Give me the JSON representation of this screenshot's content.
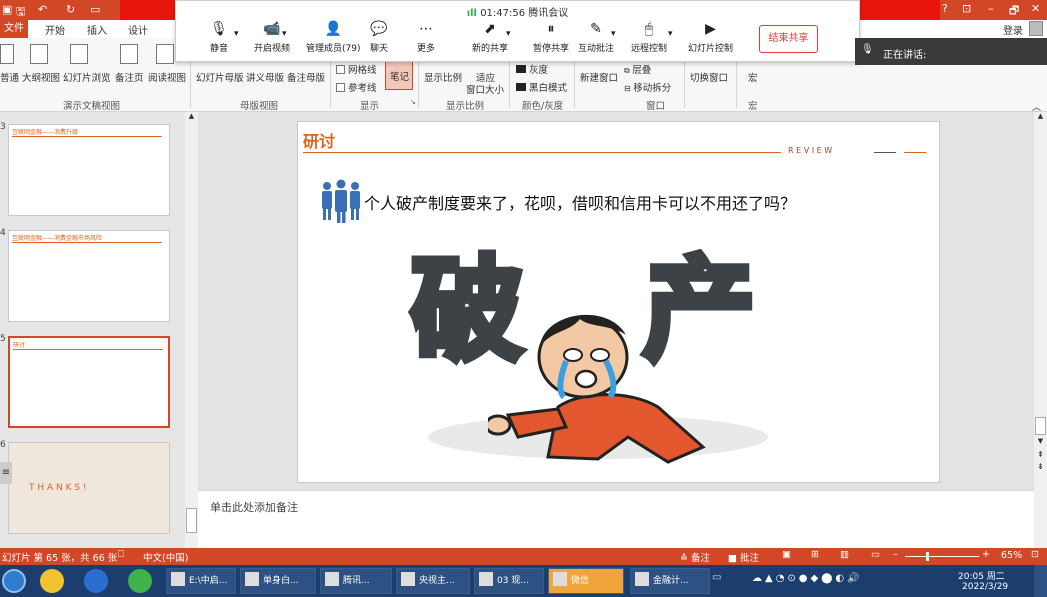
{
  "colors": {
    "accent": "#d24726",
    "taskbar": "#1c3e6e",
    "slide_title": "#e0621f",
    "end_share": "#e03a3a"
  },
  "titlebar": {
    "win_help": "?",
    "win_min": "–",
    "win_max": "🗗",
    "win_close": "✕",
    "login": "登录"
  },
  "tabs": [
    "文件",
    "开始",
    "插入",
    "设计"
  ],
  "meeting": {
    "signal": "ıll",
    "time": "01:47:56",
    "app": "腾讯会议",
    "buttons": [
      {
        "label": "静音",
        "icon": "mic-icon"
      },
      {
        "label": "开启视频",
        "icon": "video-off-icon"
      },
      {
        "label": "管理成员(79)",
        "icon": "members-icon"
      },
      {
        "label": "聊天",
        "icon": "chat-icon"
      },
      {
        "label": "更多",
        "icon": "more-icon"
      },
      {
        "label": "新的共享",
        "icon": "new-share-icon"
      },
      {
        "label": "暂停共享",
        "icon": "pause-share-icon"
      },
      {
        "label": "互动批注",
        "icon": "annotate-icon"
      },
      {
        "label": "远程控制",
        "icon": "remote-control-icon"
      },
      {
        "label": "幻灯片控制",
        "icon": "slide-control-icon"
      }
    ],
    "end_share": "结束共享"
  },
  "speaking": {
    "label": "正在讲话:"
  },
  "ribbon": {
    "views": [
      "普通",
      "大纲视图",
      "幻灯片浏览",
      "备注页",
      "阅读视图"
    ],
    "views_group": "演示文稿视图",
    "masters": [
      "幻灯片母版",
      "讲义母版",
      "备注母版"
    ],
    "masters_group": "母版视图",
    "show_items": [
      "网格线",
      "参考线"
    ],
    "notes_btn": "笔记",
    "show_group": "显示",
    "zoom": "显示比例",
    "fit": "适应",
    "fit2": "窗口大小",
    "zoom_group": "显示比例",
    "color": "灰度",
    "bw": "黑白模式",
    "color_group": "颜色/灰度",
    "new_window": "新建窗口",
    "cascade": "层叠",
    "move_split": "移动拆分",
    "switch_window": "切换窗口",
    "window_group": "窗口",
    "macro": "宏",
    "macro_group": "宏"
  },
  "thumbs": [
    {
      "num": "3",
      "title": "互联网金融——消费升级"
    },
    {
      "num": "4",
      "title": "互联网金融——消费金融市场风险"
    },
    {
      "num": "5",
      "title": "研讨"
    },
    {
      "num": "6",
      "title": "T H A N K S !"
    }
  ],
  "slide": {
    "title": "研讨",
    "review": "R E V I E W",
    "question": "个人破产制度要来了，花呗，借呗和信用卡可以不用还了吗？",
    "char1": "破",
    "char2": "产"
  },
  "notes_placeholder": "单击此处添加备注",
  "status": {
    "slide_info": "幻灯片 第 65 张，共 66 张",
    "lang": "中文(中国)",
    "notes": "备注",
    "comments": "批注",
    "zoom": "65%"
  },
  "taskbar": {
    "items": [
      "E:\\中启...",
      "单身白...",
      "腾讯...",
      "央视主...",
      "03 现...",
      "微信",
      "金融计..."
    ],
    "time": "20:05 周二",
    "date": "2022/3/29"
  }
}
